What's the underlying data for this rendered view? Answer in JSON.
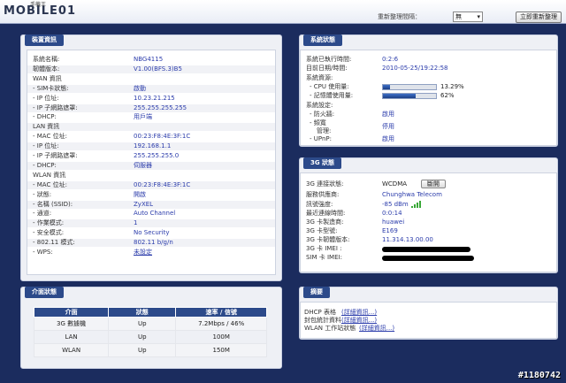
{
  "header": {
    "logo_small": "手機王",
    "logo": "MOBILE01",
    "refresh_label": "重新整理間隔：",
    "refresh_value": "無",
    "refresh_button": "立即重新整理"
  },
  "device_info": {
    "title": "裝置資訊",
    "rows": [
      {
        "label": "系統名稱:",
        "value": "NBG4115"
      },
      {
        "label": "韌體版本:",
        "value": "V1.00(BFS.3)B5"
      },
      {
        "label": "WAN 資訊",
        "value": ""
      },
      {
        "label": "- SIM卡狀態:",
        "value": "啟動"
      },
      {
        "label": "- IP 位址:",
        "value": "10.23.21.215"
      },
      {
        "label": "- IP 子網路遮罩:",
        "value": "255.255.255.255"
      },
      {
        "label": "- DHCP:",
        "value": "用戶端"
      },
      {
        "label": "LAN 資訊",
        "value": ""
      },
      {
        "label": "- MAC 位址:",
        "value": "00:23:F8:4E:3F:1C"
      },
      {
        "label": "- IP 位址:",
        "value": "192.168.1.1"
      },
      {
        "label": "- IP 子網路遮罩:",
        "value": "255.255.255.0"
      },
      {
        "label": "- DHCP:",
        "value": "伺服器"
      },
      {
        "label": "WLAN 資訊",
        "value": ""
      },
      {
        "label": "- MAC 位址:",
        "value": "00:23:F8:4E:3F:1C"
      },
      {
        "label": "- 狀態:",
        "value": "開啟"
      },
      {
        "label": "- 名稱 (SSID):",
        "value": "ZyXEL"
      },
      {
        "label": "- 通道:",
        "value": "Auto Channel"
      },
      {
        "label": "- 作業模式:",
        "value": "1"
      },
      {
        "label": "- 安全模式:",
        "value": "No Security"
      },
      {
        "label": "- 802.11 模式:",
        "value": "802.11 b/g/n"
      },
      {
        "label": "- WPS:",
        "value": "未設定"
      }
    ]
  },
  "system_status": {
    "title": "系統狀態",
    "uptime_label": "系統已執行時間:",
    "uptime": "0:2:6",
    "datetime_label": "目前日期/時間:",
    "datetime": "2010-05-25/19:22:58",
    "resources_label": "系統資源:",
    "cpu_label": "- CPU 使用量:",
    "cpu_percent": 13.29,
    "cpu_text": "13.29%",
    "mem_label": "- 記憶體使用量:",
    "mem_percent": 62,
    "mem_text": "62%",
    "settings_label": "系統設定:",
    "firewall_label": "- 防火牆:",
    "firewall": "啟用",
    "bandwidth_label1": "- 頻寬",
    "bandwidth_label2": "管理:",
    "bandwidth": "停用",
    "upnp_label": "- UPnP:",
    "upnp": "啟用"
  },
  "g3_status": {
    "title": "3G 狀態",
    "conn_label": "3G 連接狀態:",
    "conn": "WCDMA",
    "disconnect_button": "斷開",
    "provider_label": "服務供應商:",
    "provider": "Chunghwa Telecom",
    "signal_label": "訊號強度:",
    "signal": "-85 dBm",
    "time_label": "最近連線時間:",
    "time": "0:0:14",
    "manufacturer_label": "3G 卡製造商:",
    "manufacturer": "huawei",
    "model_label": "3G 卡型號:",
    "model": "E169",
    "firmware_label": "3G 卡韌體版本:",
    "firmware": "11.314.13.00.00",
    "imei_label": "3G 卡 IMEI :",
    "sim_imei_label": "SIM 卡 IMEI:"
  },
  "interface_status": {
    "title": "介面狀態",
    "headers": [
      "介面",
      "狀態",
      "速率 / 信號"
    ],
    "rows": [
      {
        "iface": "3G 數據機",
        "status": "Up",
        "rate": "7.2Mbps / 46%"
      },
      {
        "iface": "LAN",
        "status": "Up",
        "rate": "100M"
      },
      {
        "iface": "WLAN",
        "status": "Up",
        "rate": "150M"
      }
    ]
  },
  "summary": {
    "title": "摘要",
    "items": [
      {
        "label": "DHCP 表格",
        "link": "(詳細資訊...)"
      },
      {
        "label": "封包統計資料",
        "link": "(詳細資訊...)"
      },
      {
        "label": "WLAN 工作站狀態",
        "link": "(詳細資訊...)"
      }
    ]
  },
  "watermark": "#1180742"
}
